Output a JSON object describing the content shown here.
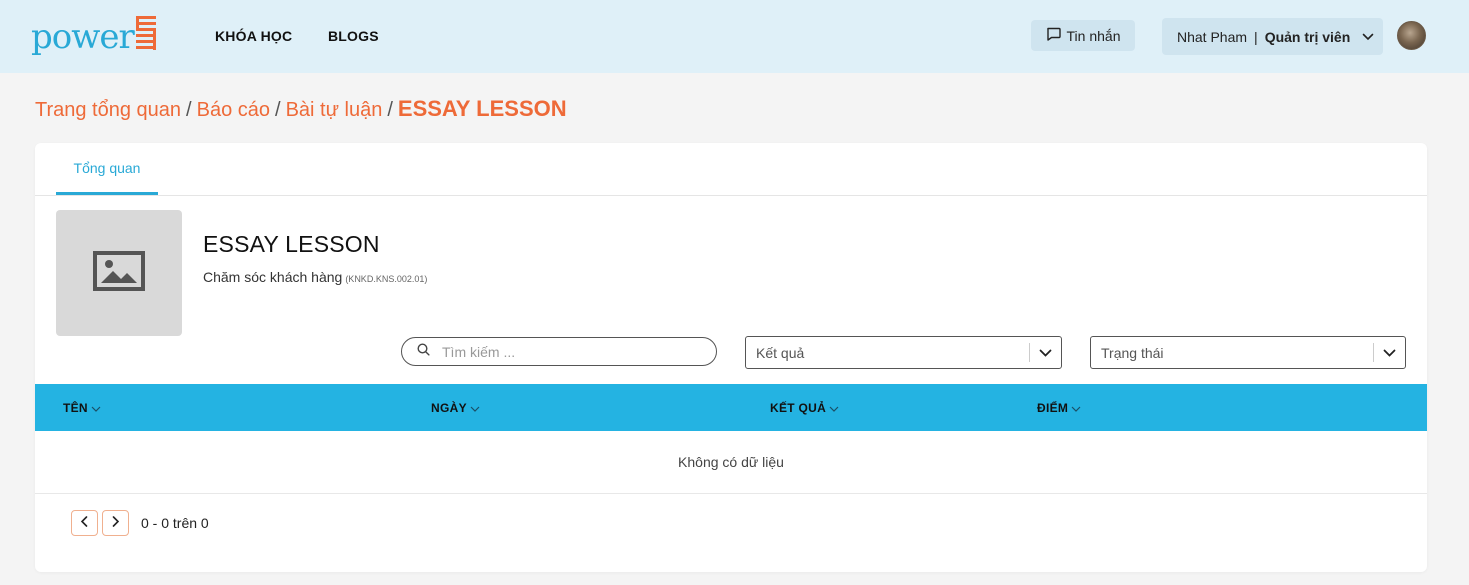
{
  "header": {
    "logo_text": "power",
    "nav": {
      "courses": "KHÓA HỌC",
      "blogs": "BLOGS"
    },
    "messages_label": "Tin nhắn",
    "user": {
      "name": "Nhat Pham",
      "separator": "|",
      "role": "Quản trị viên"
    }
  },
  "breadcrumb": {
    "items": [
      "Trang tổng quan",
      "Báo cáo",
      "Bài tự luận"
    ],
    "current": "ESSAY LESSON"
  },
  "tabs": [
    {
      "label": "Tổng quan",
      "active": true
    }
  ],
  "lesson": {
    "title": "ESSAY LESSON",
    "course": "Chăm sóc khách hàng",
    "code": "(KNKD.KNS.002.01)"
  },
  "filters": {
    "search_placeholder": "Tìm kiếm ...",
    "result_placeholder": "Kết quả",
    "status_placeholder": "Trạng thái"
  },
  "table": {
    "columns": [
      "TÊN",
      "NGÀY",
      "KẾT QUẢ",
      "ĐIỂM"
    ],
    "empty_text": "Không có dữ liệu"
  },
  "pagination": {
    "summary": "0 - 0 trên 0"
  },
  "colors": {
    "brand_orange": "#ee6a38",
    "brand_blue": "#29a9d6",
    "table_header": "#24b3e2",
    "header_bg": "#dff0f8"
  }
}
